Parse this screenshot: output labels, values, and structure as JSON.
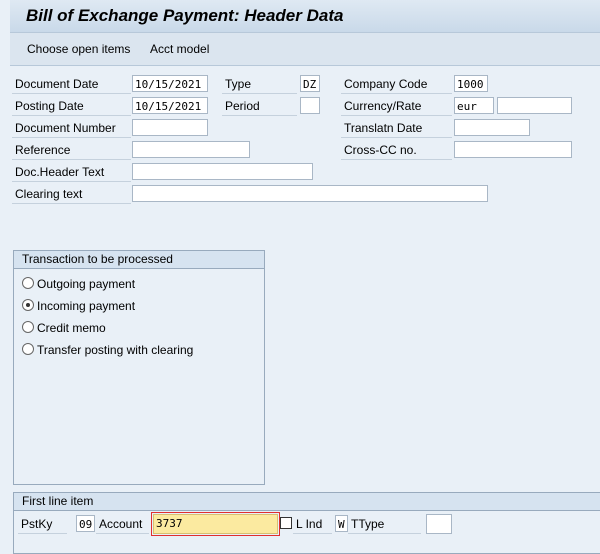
{
  "title": "Bill of Exchange Payment: Header Data",
  "toolbar": {
    "choose_open_items": "Choose open items",
    "acct_model": "Acct model"
  },
  "header": {
    "document_date_label": "Document Date",
    "document_date": "10/15/2021",
    "posting_date_label": "Posting Date",
    "posting_date": "10/15/2021",
    "document_number_label": "Document Number",
    "reference_label": "Reference",
    "doc_header_text_label": "Doc.Header Text",
    "clearing_text_label": "Clearing text",
    "type_label": "Type",
    "type": "DZ",
    "period_label": "Period",
    "company_code_label": "Company Code",
    "company_code": "1000",
    "currency_rate_label": "Currency/Rate",
    "currency": "eur",
    "translatn_date_label": "Translatn Date",
    "cross_cc_label": "Cross-CC no."
  },
  "transaction": {
    "title": "Transaction to be processed",
    "options": [
      "Outgoing payment",
      "Incoming payment",
      "Credit memo",
      "Transfer posting with clearing"
    ],
    "selected": "Incoming payment"
  },
  "first_line": {
    "title": "First line item",
    "pstky_label": "PstKy",
    "pstky": "09",
    "account_label": "Account",
    "account": "3737",
    "lind_label": "L Ind",
    "lind": "W",
    "ttype_label": "TType"
  }
}
